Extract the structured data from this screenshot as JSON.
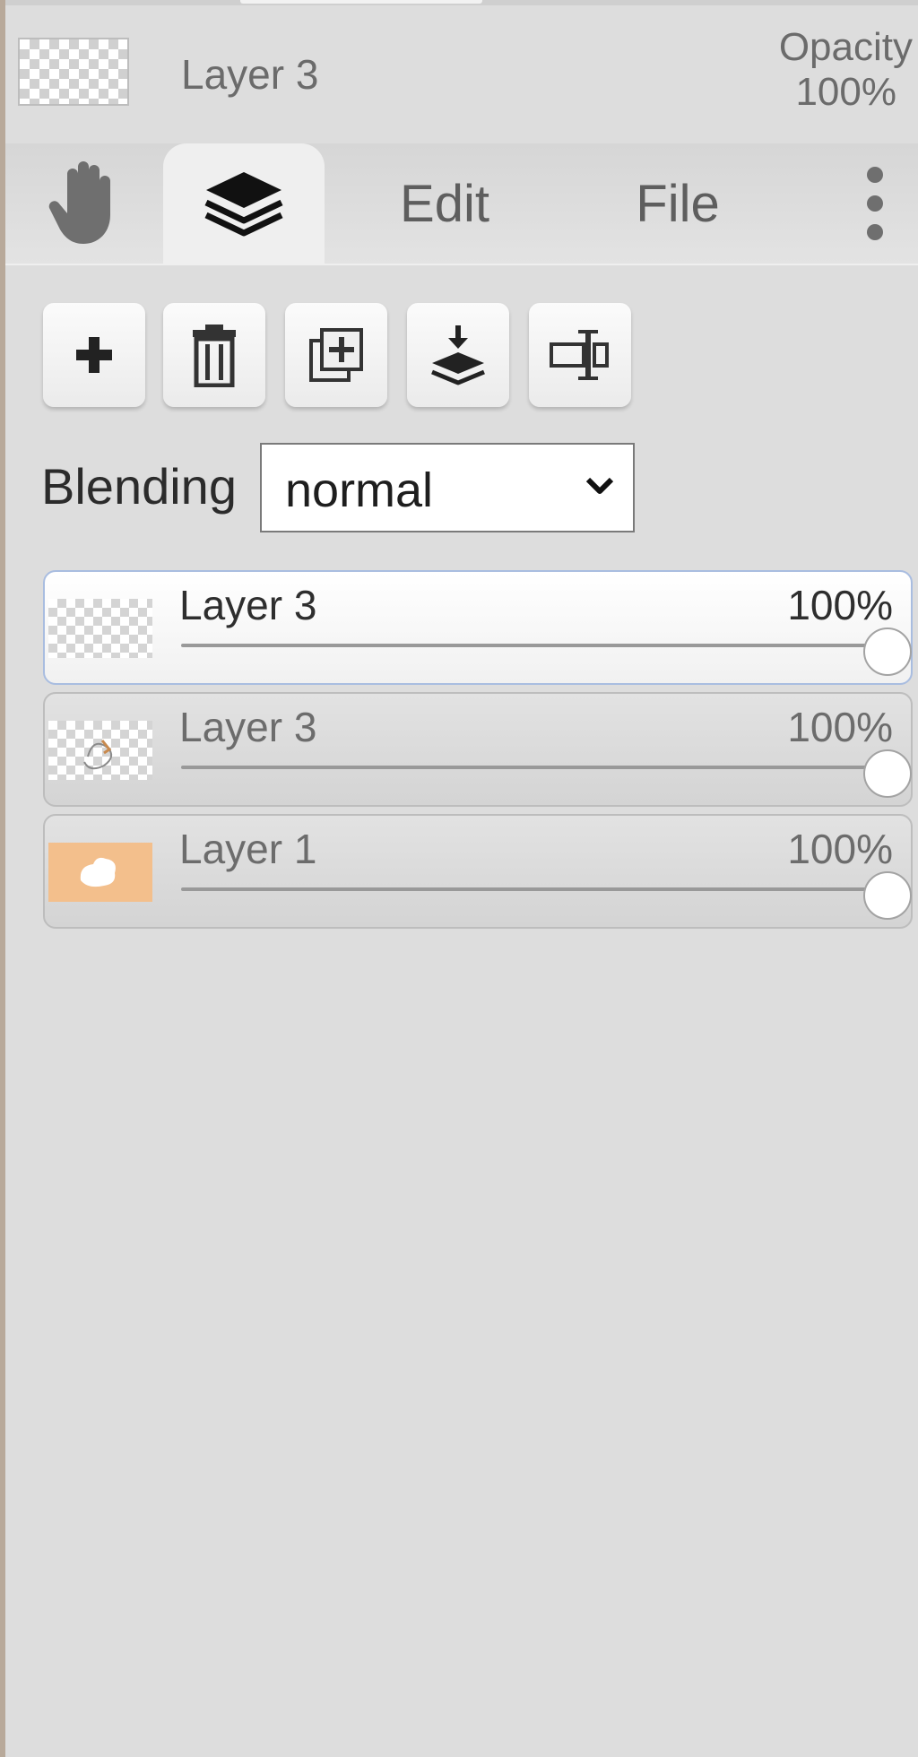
{
  "header": {
    "layer_name": "Layer 3",
    "opacity_label": "Opacity",
    "opacity_value": "100%"
  },
  "tabs": {
    "hand_icon": "hand-icon",
    "layers_icon": "layers-icon",
    "edit": "Edit",
    "file": "File",
    "more_icon": "more-vertical-icon"
  },
  "toolbar": {
    "buttons": [
      "add-layer-icon",
      "delete-layer-icon",
      "duplicate-layer-icon",
      "merge-down-icon",
      "rename-layer-icon"
    ]
  },
  "blending": {
    "label": "Blending",
    "value": "normal"
  },
  "layers": [
    {
      "name": "Layer 3",
      "opacity": "100%",
      "level": 1.0,
      "active": true
    },
    {
      "name": "Layer 3",
      "opacity": "100%",
      "level": 1.0,
      "active": false
    },
    {
      "name": "Layer 1",
      "opacity": "100%",
      "level": 1.0,
      "active": false
    }
  ],
  "colors": {
    "background": "#dddddd",
    "active_border": "#a9bde0",
    "layer1_thumb": "#f3bf8c"
  }
}
